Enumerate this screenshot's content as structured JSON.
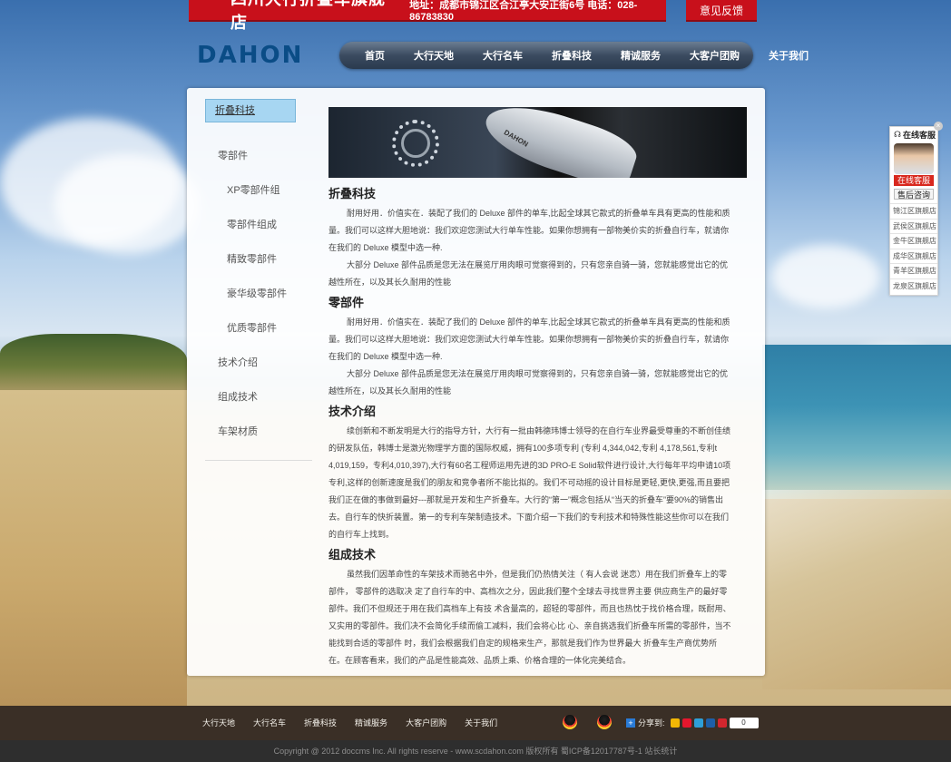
{
  "header": {
    "shop_name": "四川大行折叠车旗舰店",
    "address": "地址：成都市锦江区合江亭大安正街6号 电话：028-86783830",
    "feedback": "意见反馈",
    "logo_text": "DAHON"
  },
  "nav": [
    "首页",
    "大行天地",
    "大行名车",
    "折叠科技",
    "精诚服务",
    "大客户团购",
    "关于我们"
  ],
  "sidebar": {
    "active": "折叠科技",
    "items": [
      {
        "label": "零部件",
        "level": 1
      },
      {
        "label": "XP零部件组",
        "level": 2
      },
      {
        "label": "零部件组成",
        "level": 2
      },
      {
        "label": "精致零部件",
        "level": 2
      },
      {
        "label": "豪华级零部件",
        "level": 2
      },
      {
        "label": "优质零部件",
        "level": 2
      },
      {
        "label": "技术介绍",
        "level": 1
      },
      {
        "label": "组成技术",
        "level": 1
      },
      {
        "label": "车架材质",
        "level": 1
      }
    ]
  },
  "hero": {
    "saddle_logo": "DAHON"
  },
  "sections": [
    {
      "title": "折叠科技",
      "paragraphs": [
        "耐用好用．价值实在．装配了我们的 Deluxe 部件的单车,比起全球其它款式的折叠单车具有更高的性能和质量。我们可以这样大胆地说：我们欢迎您测试大行单车性能。如果你想拥有一部物美价实的折叠自行车，就请你在我们的 Deluxe 模型中选一种.",
        "大部分 Deluxe 部件品质是您无法在展览厅用肉眼可觉察得到的，只有您亲自骑一骑，您就能感觉出它的优越性所在，以及其长久耐用的性能"
      ]
    },
    {
      "title": "零部件",
      "paragraphs": [
        "耐用好用．价值实在．装配了我们的 Deluxe 部件的单车,比起全球其它款式的折叠单车具有更高的性能和质量。我们可以这样大胆地说：我们欢迎您测试大行单车性能。如果你想拥有一部物美价实的折叠自行车，就请你在我们的 Deluxe 模型中选一种.",
        "大部分 Deluxe 部件品质是您无法在展览厅用肉眼可觉察得到的，只有您亲自骑一骑，您就能感觉出它的优越性所在，以及其长久耐用的性能"
      ]
    },
    {
      "title": "技术介绍",
      "paragraphs": [
        "续创新和不断发明是大行的指导方针，大行有一批由韩德玮博士领导的在自行车业界最受尊重的不断创佳绩的研发队伍，韩博士是激光物理学方面的国际权威，拥有100多项专利 (专利 4,344,042,专利 4,178,561,专利t 4,019,159，专利4,010,397),大行有60名工程师运用先进的3D PRO-E Solid软件进行设计,大行每年平均申请10项专利,这样的创新速度是我们的朋友和竞争者所不能比拟的。我们不可动摇的设计目标是更轻,更快,更强,而且要把我们正在做的事做到最好---那就是开发和生产折叠车。大行的“第一”概念包括从“当天的折叠车”要90%的销售出去。自行车的快折装置。第一的专利车架制造技术。下面介绍一下我们的专利技术和特殊性能这些你可以在我们的自行车上找到。"
      ]
    },
    {
      "title": "组成技术",
      "paragraphs": [
        "虽然我们因革命性的车架技术而驰名中外，但是我们仍热情关注（ 有人会说 迷恋）用在我们折叠车上的零部件， 零部件的选取决 定了自行车的中、高档次之分，因此我们整个全球去寻找世界主要 供应商生产的最好零部件。我们不但规还于用在我们高档车上有技 术含量高的，超轻的零部件，而且也热忱于找价格合理，既耐用、又实用的零部件。我们决不会简化手续而偷工减料，我们会将心比 心、亲自挑选我们折叠车所需的零部件，当不能找到合适的零部件 时，我们会根据我们自定的规格来生产，那就是我们作为世界最大 折叠车生产商优势所在。在顾客看来，我们的产品是性能高效、品质上乘、价格合理的一体化完美结合。"
      ]
    }
  ],
  "service": {
    "title": "在线客服",
    "btn_online": "在线客服",
    "btn_sales": "售后咨询",
    "stores": [
      "锦江区旗舰店",
      "武侯区旗舰店",
      "金牛区旗舰店",
      "成华区旗舰店",
      "青羊区旗舰店",
      "龙泉区旗舰店"
    ],
    "close": "×"
  },
  "footer": {
    "links": [
      "大行天地",
      "大行名车",
      "折叠科技",
      "精诚服务",
      "大客户团购",
      "关于我们"
    ],
    "share_label": "分享到:",
    "share_count": "0",
    "copyright": "Copyright @ 2012 doccms Inc. All rights reserve - www.scdahon.com   版权所有  蜀ICP备12017787号-1  站长统计"
  }
}
